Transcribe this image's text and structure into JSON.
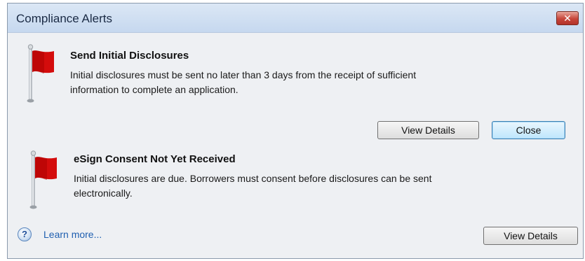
{
  "window": {
    "title": "Compliance Alerts",
    "close_glyph": "✕"
  },
  "alerts": [
    {
      "title": "Send Initial Disclosures",
      "line1": "Initial disclosures must be sent no later than 3 days from the receipt of sufficient",
      "line2": "information to complete an application.",
      "buttons": {
        "view_details": "View Details",
        "close": "Close"
      }
    },
    {
      "title": "eSign Consent Not Yet Received",
      "line1": "Initial disclosures are due. Borrowers must consent before disclosures can be sent",
      "line2": "electronically.",
      "buttons": {
        "view_details": "View Details"
      }
    }
  ],
  "footer": {
    "help_glyph": "?",
    "learn_more": "Learn more..."
  },
  "colors": {
    "flag": "#d40c0c",
    "link": "#1f5fb0",
    "titlebar": "#c6d8ef",
    "close_button": "#c7453a"
  },
  "icons": [
    "red-flag-icon",
    "help-question-icon",
    "close-icon"
  ]
}
